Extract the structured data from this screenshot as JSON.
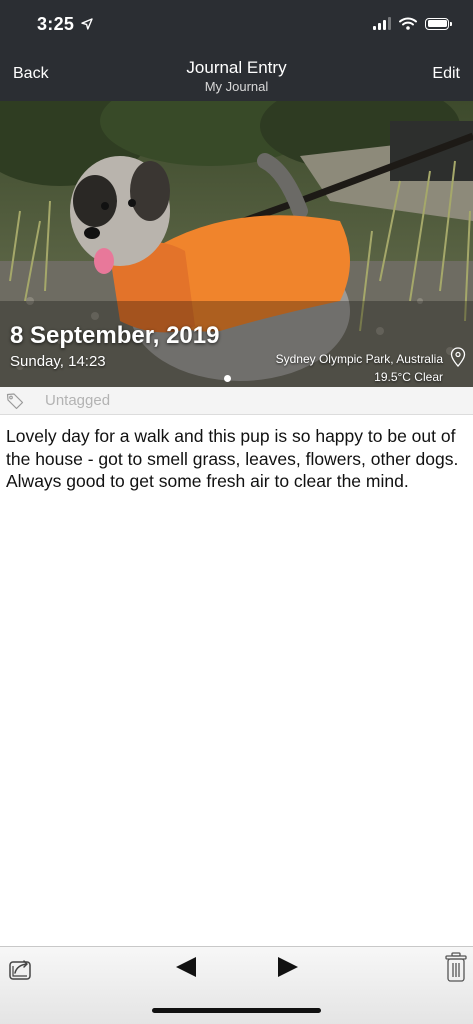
{
  "status": {
    "time": "3:25"
  },
  "nav": {
    "back_label": "Back",
    "edit_label": "Edit",
    "title": "Journal Entry",
    "subtitle": "My Journal"
  },
  "entry": {
    "date": "8 September, 2019",
    "day_time": "Sunday, 14:23",
    "location": "Sydney Olympic Park, Australia",
    "weather": "19.5°C Clear",
    "tag": "Untagged",
    "text": "Lovely day for a walk and this pup is so happy to be out of the house - got to smell grass, leaves, flowers, other dogs. Always good to get some fresh air to clear the mind.",
    "photo_icon": "photo-of-dog"
  },
  "toolbar": {
    "share_icon": "share-icon",
    "prev_icon": "previous-icon",
    "next_icon": "next-icon",
    "trash_icon": "trash-icon"
  },
  "colors": {
    "nav_bg": "#2b2e33",
    "text": "#111111",
    "tag_text": "#b3b3b3"
  }
}
